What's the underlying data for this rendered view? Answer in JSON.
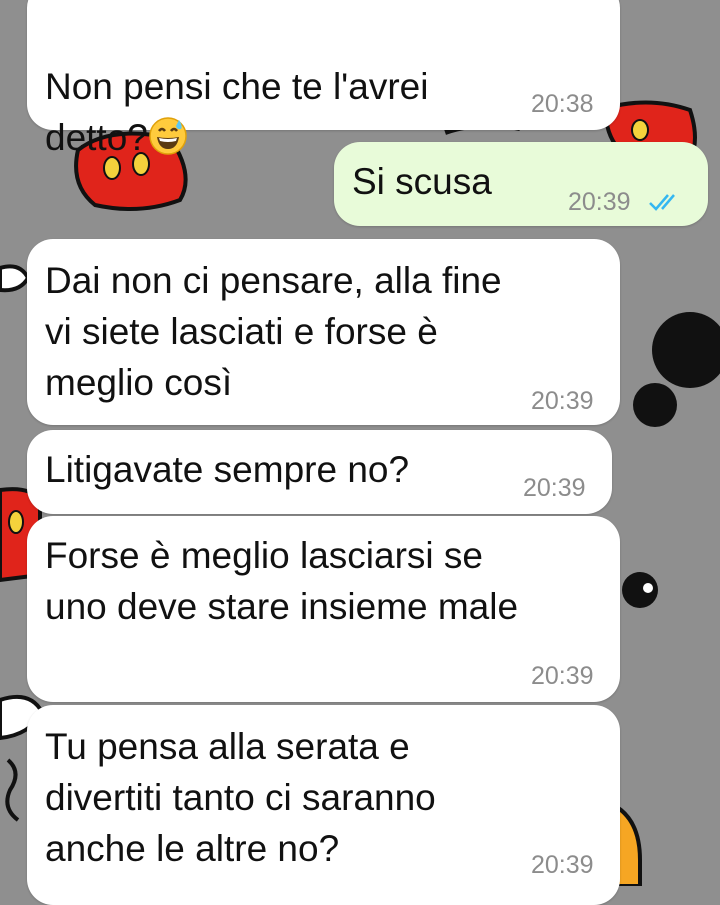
{
  "chat": {
    "messages": [
      {
        "direction": "incoming",
        "text": "Non pensi che te l'avrei\ndetto?",
        "emoji": "grinning-sweat-emoji",
        "time": "20:38"
      },
      {
        "direction": "outgoing",
        "text": "Si scusa",
        "time": "20:39",
        "status": "read"
      },
      {
        "direction": "incoming",
        "text": "Dai non ci pensare, alla fine\nvi siete lasciati e forse è\nmeglio così",
        "time": "20:39"
      },
      {
        "direction": "incoming",
        "text": "Litigavate sempre no?",
        "time": "20:39"
      },
      {
        "direction": "incoming",
        "text": "Forse è meglio lasciarsi se\nuno deve stare insieme male",
        "time": "20:39"
      },
      {
        "direction": "incoming",
        "text": "Tu pensa alla serata e\ndivertiti tanto ci saranno\nanche le altre no?",
        "time": "20:39"
      }
    ]
  },
  "colors": {
    "wallpaper": "#8f8f8f",
    "incoming_bubble": "#ffffff",
    "outgoing_bubble": "#e8fbd9",
    "read_ticks": "#34b7f1",
    "time_text": "#8c8c8c"
  },
  "icons": {
    "wallpaper_pattern": "mickey-mouse-pattern",
    "read_receipt": "double-check-icon"
  }
}
